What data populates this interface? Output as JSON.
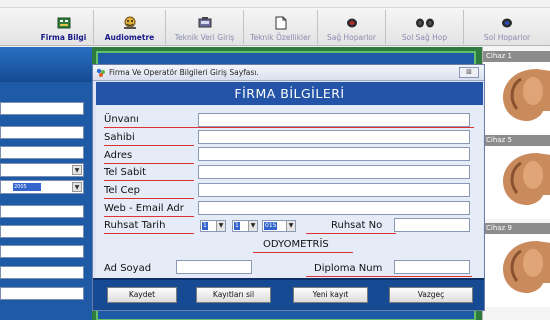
{
  "toolbar": {
    "items": [
      {
        "label": "Firma Bilgi",
        "icon": "company-icon",
        "enabled": true
      },
      {
        "label": "Audiometre",
        "icon": "audiometer-icon",
        "enabled": true
      },
      {
        "label": "Teknik Veri Giriş",
        "icon": "technical-data-icon",
        "enabled": false
      },
      {
        "label": "Teknik Özellikler",
        "icon": "document-icon",
        "enabled": false
      },
      {
        "label": "Sağ Hoparlor",
        "icon": "right-speaker-icon",
        "enabled": false
      },
      {
        "label": "Sol Sağ Hop",
        "icon": "stereo-speakers-icon",
        "enabled": false
      },
      {
        "label": "Sol Hoparlor",
        "icon": "left-speaker-icon",
        "enabled": false
      }
    ]
  },
  "left_panel": {
    "combo_value": "2005"
  },
  "devices": [
    {
      "label": "Cihaz 1"
    },
    {
      "label": "Cihaz 5"
    },
    {
      "label": "Cihaz 9"
    }
  ],
  "dialog": {
    "title": "Firma Ve Operatör Bilgileri Giriş Sayfası.",
    "close_label": "⊠",
    "banner": "FİRMA BİLGİLERİ",
    "fields": {
      "unvan": {
        "label": "Ünvanı",
        "value": ""
      },
      "sahibi": {
        "label": "Sahibi",
        "value": ""
      },
      "adres": {
        "label": "Adres",
        "value": ""
      },
      "tel_sabit": {
        "label": "Tel Sabit",
        "value": ""
      },
      "tel_cep": {
        "label": "Tel Cep",
        "value": ""
      },
      "web_email": {
        "label": "Web - Email Adr",
        "value": ""
      }
    },
    "ruhsat": {
      "label": "Ruhsat Tarih",
      "day": "1",
      "month": "1",
      "year": "015",
      "no_label": "Ruhsat No",
      "no_value": ""
    },
    "section_title": "ODYOMETRİS",
    "odyometris": {
      "ad_soyad_label": "Ad Soyad",
      "diploma_label": "Diploma Num"
    },
    "buttons": {
      "save": "Kaydet",
      "delete": "Kayıtları sil",
      "new": "Yeni kayıt",
      "cancel": "Vazgeç"
    }
  },
  "colors": {
    "dialog_banner": "#2454a8",
    "underline": "#dd3333",
    "button_bar": "#164a92",
    "workspace_border": "#2d7b3d"
  }
}
